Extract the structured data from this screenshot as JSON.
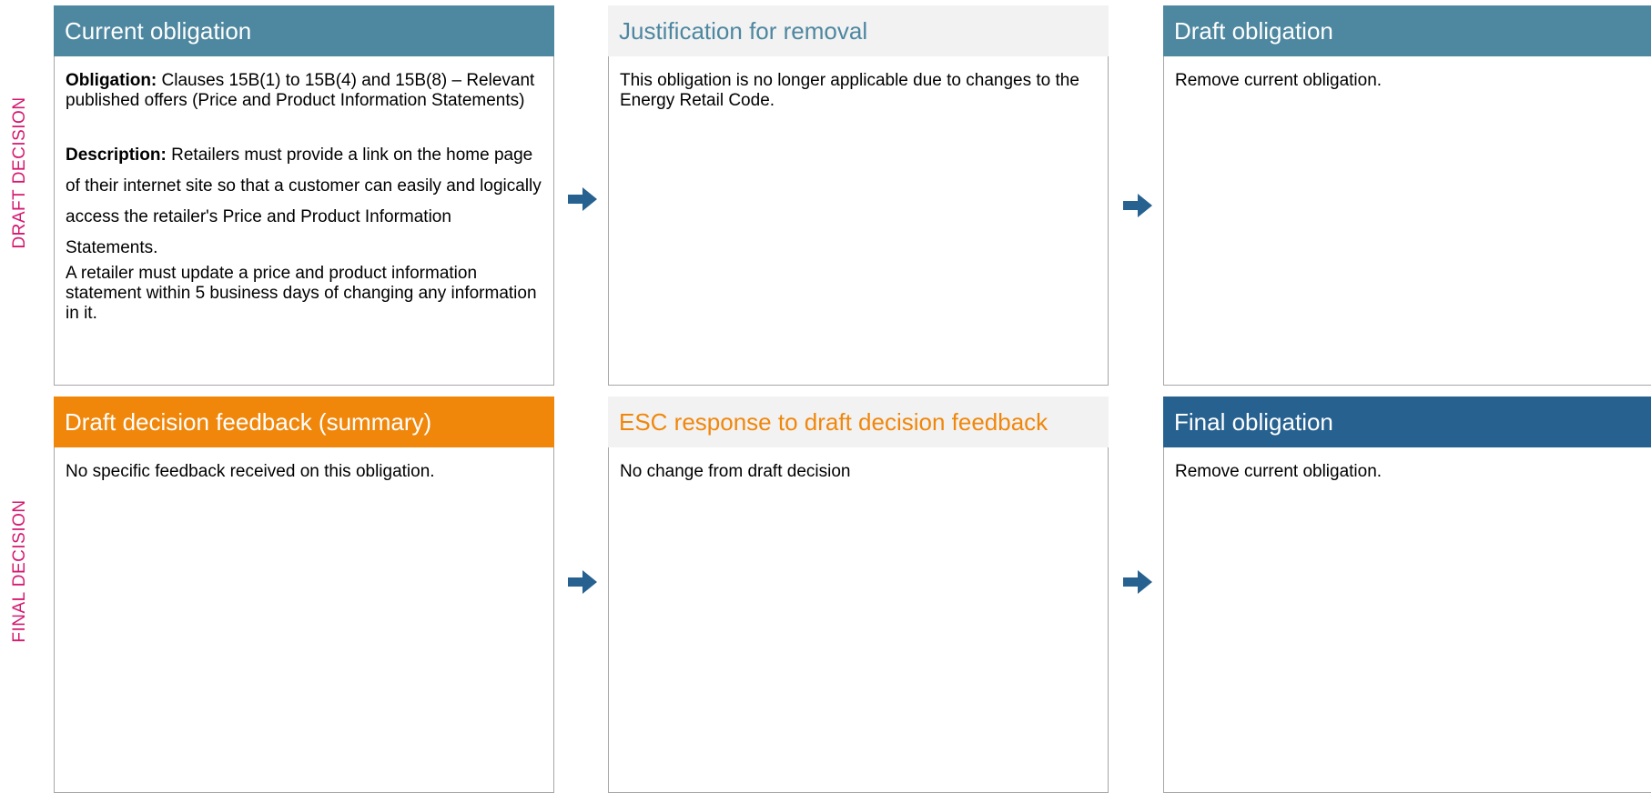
{
  "side_labels": {
    "top": "DRAFT DECISION",
    "bottom": "FINAL DECISION"
  },
  "colors": {
    "teal": "#4d87a0",
    "navy": "#276190",
    "orange": "#f0870b",
    "magenta": "#d6186f",
    "arrow": "#276190"
  },
  "current_obligation": {
    "title": "Current obligation",
    "obligation_label": "Obligation:",
    "obligation_text": "Clauses 15B(1) to 15B(4) and 15B(8) – Relevant published offers (Price and Product Information Statements)",
    "description_label": "Description:",
    "description_text": "Retailers must provide a link on the home page of their internet site so that a customer can easily and logically access the retailer's Price and Product Information Statements.",
    "extra_text": "A retailer must update a price and product information statement within 5 business days of changing any information in it."
  },
  "justification": {
    "title": "Justification for removal",
    "text": "This obligation is no longer applicable due to changes to the Energy Retail Code."
  },
  "draft_obligation": {
    "title": "Draft obligation",
    "text": "Remove current obligation."
  },
  "feedback": {
    "title": "Draft decision feedback (summary)",
    "text": "No specific feedback received on this obligation."
  },
  "esc_response": {
    "title": "ESC response to draft decision feedback",
    "text": "No change from draft decision"
  },
  "final_obligation": {
    "title": "Final obligation",
    "text": "Remove current obligation."
  },
  "arrows": [
    "arrow-icon",
    "arrow-icon",
    "arrow-icon",
    "arrow-icon"
  ]
}
